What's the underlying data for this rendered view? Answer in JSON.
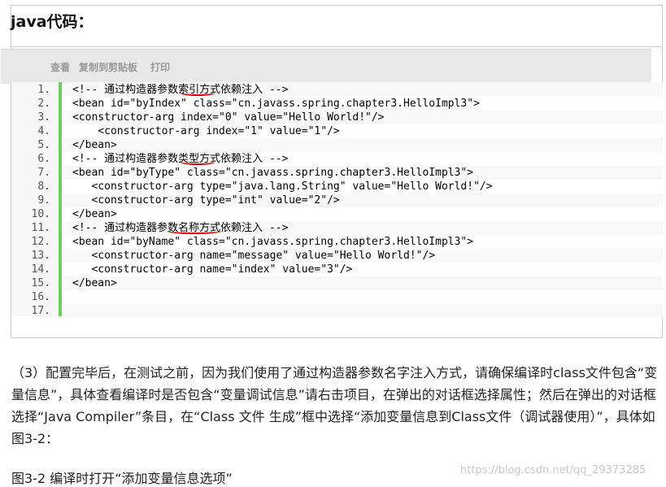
{
  "code_block": {
    "title": "java代码：",
    "toolbar": {
      "view": "查看",
      "copy": "复制到剪贴板",
      "print": "打印"
    },
    "lines": [
      {
        "n": "1.",
        "text": "<!-- 通过构造器参数索引方式依赖注入 -->"
      },
      {
        "n": "2.",
        "text": "<bean id=\"byIndex\" class=\"cn.javass.spring.chapter3.HelloImpl3\">"
      },
      {
        "n": "3.",
        "text": "<constructor-arg index=\"0\" value=\"Hello World!\"/>"
      },
      {
        "n": "4.",
        "text": "    <constructor-arg index=\"1\" value=\"1\"/>"
      },
      {
        "n": "5.",
        "text": "</bean>"
      },
      {
        "n": "6.",
        "text": "<!-- 通过构造器参数类型方式依赖注入 -->"
      },
      {
        "n": "7.",
        "text": "<bean id=\"byType\" class=\"cn.javass.spring.chapter3.HelloImpl3\">"
      },
      {
        "n": "8.",
        "text": "   <constructor-arg type=\"java.lang.String\" value=\"Hello World!\"/>"
      },
      {
        "n": "9.",
        "text": "   <constructor-arg type=\"int\" value=\"2\"/>"
      },
      {
        "n": "10.",
        "text": "</bean>"
      },
      {
        "n": "11.",
        "text": "<!-- 通过构造器参数名称方式依赖注入 -->"
      },
      {
        "n": "12.",
        "text": "<bean id=\"byName\" class=\"cn.javass.spring.chapter3.HelloImpl3\">"
      },
      {
        "n": "13.",
        "text": "   <constructor-arg name=\"message\" value=\"Hello World!\"/>"
      },
      {
        "n": "14.",
        "text": "   <constructor-arg name=\"index\" value=\"3\"/>"
      },
      {
        "n": "15.",
        "text": "</bean>"
      },
      {
        "n": "16.",
        "text": ""
      },
      {
        "n": "17.",
        "text": ""
      }
    ]
  },
  "paragraph": "（3）配置完毕后，在测试之前，因为我们使用了通过构造器参数名字注入方式，请确保编译时class文件包含“变量信息”，具体查看编译时是否包含“变量调试信息”请右击项目，在弹出的对话框选择属性；然后在弹出的对话框选择“Java Compiler”条目，在“Class 文件 生成”框中选择“添加变量信息到Class文件（调试器使用）”，具体如图3-2：",
  "figure_caption": "图3-2 编译时打开“添加变量信息选项”",
  "watermark": "https://blog.csdn.net/qq_29373285"
}
